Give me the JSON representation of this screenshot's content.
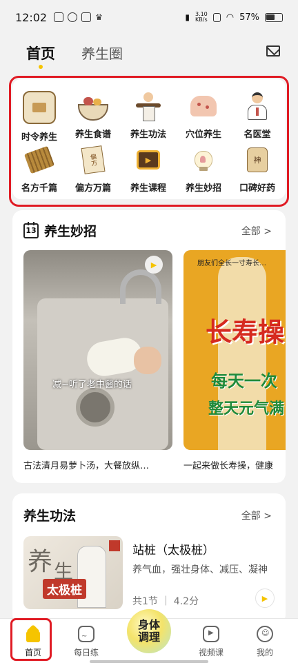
{
  "status_bar": {
    "time": "12:02",
    "net_speed_value": "3.10",
    "net_speed_unit": "KB/s",
    "battery": "57%"
  },
  "top_tabs": [
    {
      "label": "首页",
      "active": true
    },
    {
      "label": "养生圈",
      "active": false
    }
  ],
  "categories": [
    {
      "label": "时令养生",
      "icon": "calendar-icon"
    },
    {
      "label": "养生食谱",
      "icon": "food-bowl-icon"
    },
    {
      "label": "养生功法",
      "icon": "taichi-icon"
    },
    {
      "label": "穴位养生",
      "icon": "acupoint-icon"
    },
    {
      "label": "名医堂",
      "icon": "doctor-icon"
    },
    {
      "label": "名方千篇",
      "icon": "scroll-icon"
    },
    {
      "label": "偏方万篇",
      "icon": "prescription-icon",
      "icon_text": "偏方"
    },
    {
      "label": "养生课程",
      "icon": "video-course-icon"
    },
    {
      "label": "养生妙招",
      "icon": "lightbulb-icon"
    },
    {
      "label": "口碑好药",
      "icon": "medicine-jar-icon",
      "icon_text": "神"
    }
  ],
  "tips_section": {
    "title": "养生妙招",
    "calendar_day": "13",
    "more_label": "全部 >",
    "cards": [
      {
        "overlay_text": "减~听了老中醫的话",
        "caption": "古法清月易萝卜汤，大餐放纵…"
      },
      {
        "top_text": "朋友们全长一寸寿长…",
        "big_text": "长寿操",
        "sub_text_1": "每天一次",
        "sub_text_2": "整天元气满",
        "caption": "一起来做长寿操，健康"
      }
    ]
  },
  "exercise_section": {
    "title": "养生功法",
    "more_label": "全部 >",
    "item": {
      "thumb_text_1": "养",
      "thumb_text_2": "生",
      "thumb_banner": "太极桩",
      "title": "站桩（太极桩）",
      "description": "养气血，强壮身体、减压、凝神",
      "meta": "共1节 ｜ 4.2分"
    }
  },
  "bottom_nav": [
    {
      "label": "首页",
      "icon": "home-icon",
      "active": true
    },
    {
      "label": "每日练",
      "icon": "daily-practice-icon",
      "active": false
    },
    {
      "label": "身体调理",
      "icon": "body-care-icon",
      "active": false
    },
    {
      "label": "视频课",
      "icon": "video-icon",
      "active": false
    },
    {
      "label": "我的",
      "icon": "profile-icon",
      "active": false
    }
  ],
  "colors": {
    "accent_yellow": "#f5c400",
    "highlight_red": "#e01b24",
    "background": "#f2f2f2"
  }
}
